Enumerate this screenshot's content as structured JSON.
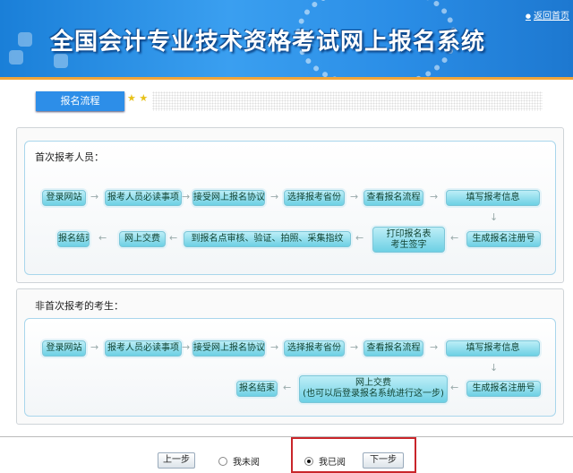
{
  "header": {
    "title": "全国会计专业技术资格考试网上报名系统",
    "home_link": "返回首页"
  },
  "tab": {
    "label": "报名流程"
  },
  "first_time": {
    "title": "首次报考人员：",
    "row1": [
      "登录网站",
      "报考人员必读事项",
      "接受网上报名协议",
      "选择报考省份",
      "查看报名流程",
      "填写报考信息"
    ],
    "row2": [
      "报名结束",
      "网上交费",
      "到报名点审核、验证、拍照、采集指纹",
      "打印报名表",
      "考生签字",
      "生成报名注册号"
    ]
  },
  "returning": {
    "title": "非首次报考的考生：",
    "row1": [
      "登录网站",
      "报考人员必读事项",
      "接受网上报名协议",
      "选择报考省份",
      "查看报名流程",
      "填写报考信息"
    ],
    "row2": [
      "报名结束",
      "网上交费",
      "(也可以后登录报名系统进行这一步)",
      "生成报名注册号"
    ]
  },
  "footer": {
    "prev": "上一步",
    "not_read": "我未阅",
    "read": "我已阅",
    "next": "下一步",
    "selected": "我已阅"
  }
}
